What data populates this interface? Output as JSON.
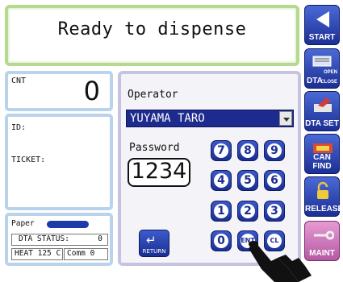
{
  "status": {
    "message": "Ready to dispense"
  },
  "counter": {
    "label": "CNT",
    "value": "0"
  },
  "ticket_info": {
    "id_label": "ID:",
    "ticket_label": "TICKET:"
  },
  "machine_info": {
    "paper_label": "Paper",
    "dta_status_label": "DTA STATUS:",
    "dta_status_value": "0",
    "heat_label": "HEAT 125 C",
    "comm_label": "Comm 0"
  },
  "login": {
    "operator_label": "Operator",
    "operator_value": "YUYAMA TARO",
    "password_label": "Password",
    "password_value": "1234",
    "keypad": [
      "7",
      "8",
      "9",
      "4",
      "5",
      "6",
      "1",
      "2",
      "3",
      "0",
      "ENT",
      "CL"
    ],
    "return_label": "RETURN"
  },
  "side_buttons": {
    "start": "START",
    "dta_open_close_main": "DTA",
    "dta_open_close_top": "OPEN",
    "dta_open_close_bottom": "CLOSE",
    "dta_set": "DTA SET",
    "can_find": "CAN FIND",
    "release": "RELEASE",
    "maint": "MAINT"
  },
  "colors": {
    "status_border": "#b6d88f",
    "info_border": "#b9d3ec",
    "login_border": "#c6c3e1",
    "button_blue": "#1c2f94",
    "maint_pink": "#b45aa3",
    "paper_indicator": "#1d3ba8"
  }
}
